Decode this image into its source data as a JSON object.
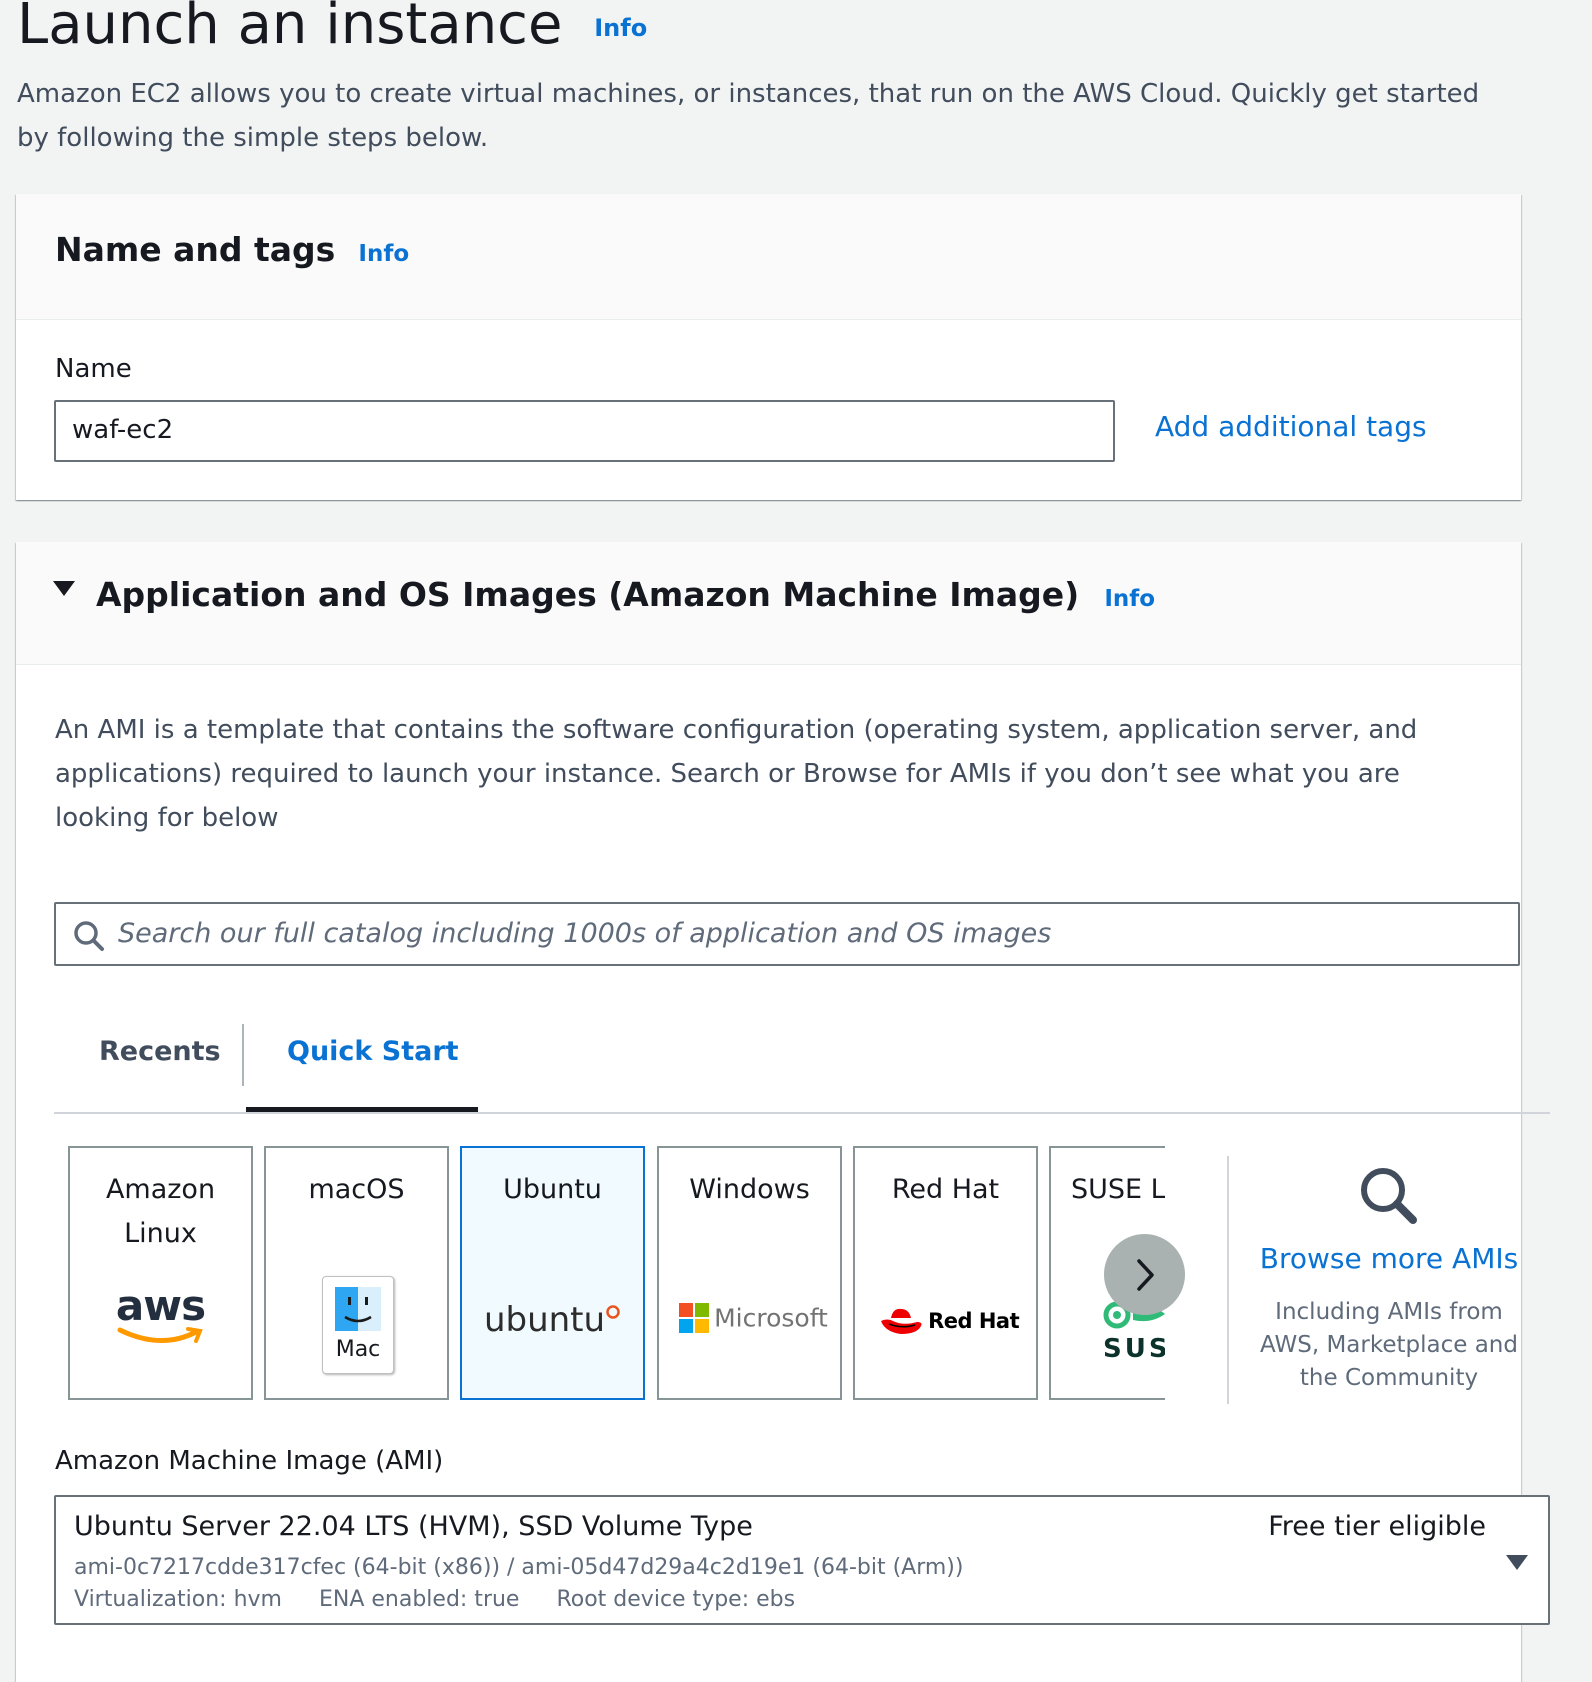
{
  "header": {
    "title": "Launch an instance",
    "info": "Info",
    "description": "Amazon EC2 allows you to create virtual machines, or instances, that run on the AWS Cloud. Quickly get started by following the simple steps below."
  },
  "name_tags": {
    "title": "Name and tags",
    "info": "Info",
    "name_label": "Name",
    "name_value": "waf-ec2",
    "add_tags": "Add additional tags"
  },
  "ami_section": {
    "title": "Application and OS Images (Amazon Machine Image)",
    "info": "Info",
    "description": "An AMI is a template that contains the software configuration (operating system, application server, and applications) required to launch your instance. Search or Browse for AMIs if you don’t see what you are looking for below",
    "search_placeholder": "Search our full catalog including 1000s of application and OS images",
    "tabs": [
      {
        "label": "Recents"
      },
      {
        "label": "Quick Start"
      }
    ],
    "cards": [
      {
        "label": "Amazon Linux",
        "logo_text": "aws",
        "icon": "aws-logo"
      },
      {
        "label": "macOS",
        "logo_text": "Mac",
        "icon": "mac-finder-icon"
      },
      {
        "label": "Ubuntu",
        "logo_text": "ubuntu",
        "icon": "ubuntu-logo"
      },
      {
        "label": "Windows",
        "logo_text": "Microsoft",
        "icon": "microsoft-logo"
      },
      {
        "label": "Red Hat",
        "logo_text": "Red Hat",
        "icon": "redhat-logo"
      },
      {
        "label": "SUSE Li",
        "logo_text": "SUS",
        "icon": "suse-logo"
      }
    ],
    "selected_card": "Ubuntu",
    "browse": {
      "link": "Browse more AMIs",
      "note": "Including AMIs from AWS, Marketplace and the Community"
    },
    "ami_label": "Amazon Machine Image (AMI)",
    "ami_selected": {
      "name": "Ubuntu Server 22.04 LTS (HVM), SSD Volume Type",
      "badge": "Free tier eligible",
      "ids": "ami-0c7217cdde317cfec (64-bit (x86)) / ami-05d47d29a4c2d19e1 (64-bit (Arm))",
      "virtualization": "Virtualization: hvm",
      "ena": "ENA enabled: true",
      "root_device": "Root device type: ebs"
    }
  },
  "colors": {
    "link": "#0972d3",
    "text": "#16191f",
    "background": "#f2f3f3",
    "selected_card_bg": "#f1faff"
  }
}
